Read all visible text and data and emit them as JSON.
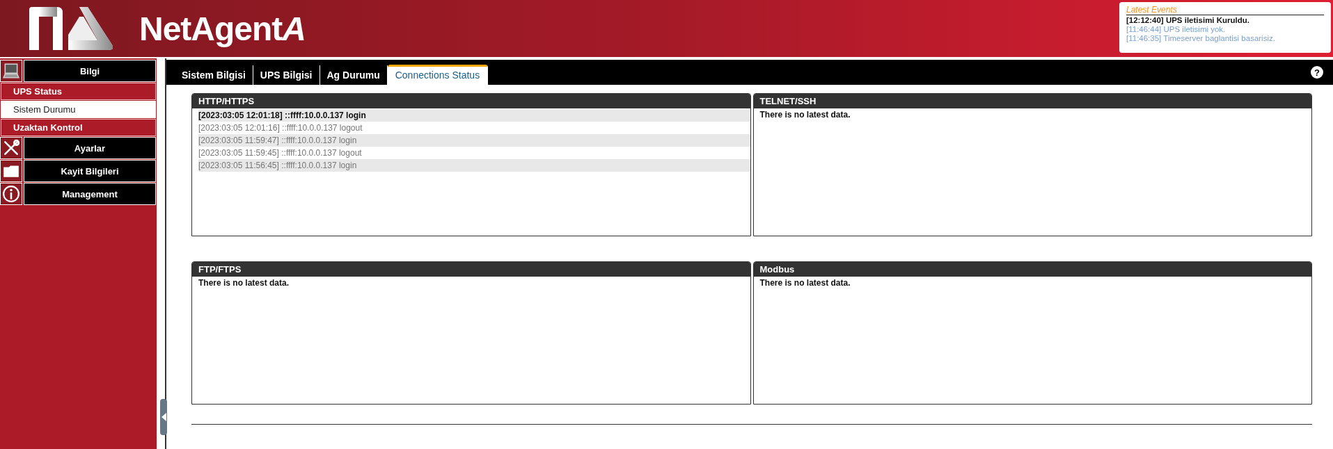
{
  "brand": {
    "name": "NetAgent",
    "suffix": "A"
  },
  "latest_events": {
    "title": "Latest Events",
    "items": [
      {
        "text": "[12:12:40] UPS iletisimi Kuruldu.",
        "recent": true
      },
      {
        "text": "[11:46:44] UPS iletisimi yok.",
        "recent": false
      },
      {
        "text": "[11:46:35] Timeserver baglantisi basarisiz.",
        "recent": false
      }
    ]
  },
  "sidebar": {
    "items": [
      {
        "kind": "computer",
        "label": "Bilgi"
      },
      {
        "kind": "sub",
        "label": "UPS Status",
        "selected": false
      },
      {
        "kind": "sub",
        "label": "Sistem Durumu",
        "selected": true
      },
      {
        "kind": "sub",
        "label": "Uzaktan Kontrol",
        "selected": false
      },
      {
        "kind": "tools",
        "label": "Ayarlar"
      },
      {
        "kind": "folder",
        "label": "Kayit Bilgileri"
      },
      {
        "kind": "info",
        "label": "Management"
      }
    ]
  },
  "tabs": [
    {
      "label": "Sistem Bilgisi",
      "selected": false
    },
    {
      "label": "UPS Bilgisi",
      "selected": false
    },
    {
      "label": "Ag Durumu",
      "selected": false
    },
    {
      "label": "Connections Status",
      "selected": true
    }
  ],
  "help": "?",
  "panels": [
    {
      "title": "HTTP/HTTPS",
      "rows": [
        {
          "text": "[2023:03:05 12:01:18] ::ffff:10.0.0.137 login",
          "latest": true
        },
        {
          "text": "[2023:03:05 12:01:16] ::ffff:10.0.0.137 logout",
          "latest": false
        },
        {
          "text": "[2023:03:05 11:59:47] ::ffff:10.0.0.137 login",
          "latest": false
        },
        {
          "text": "[2023:03:05 11:59:45] ::ffff:10.0.0.137 logout",
          "latest": false
        },
        {
          "text": "[2023:03:05 11:56:45] ::ffff:10.0.0.137 login",
          "latest": false
        }
      ]
    },
    {
      "title": "TELNET/SSH",
      "empty_text": "There is no latest data."
    },
    {
      "title": "FTP/FTPS",
      "empty_text": "There is no latest data."
    },
    {
      "title": "Modbus",
      "empty_text": "There is no latest data."
    }
  ]
}
